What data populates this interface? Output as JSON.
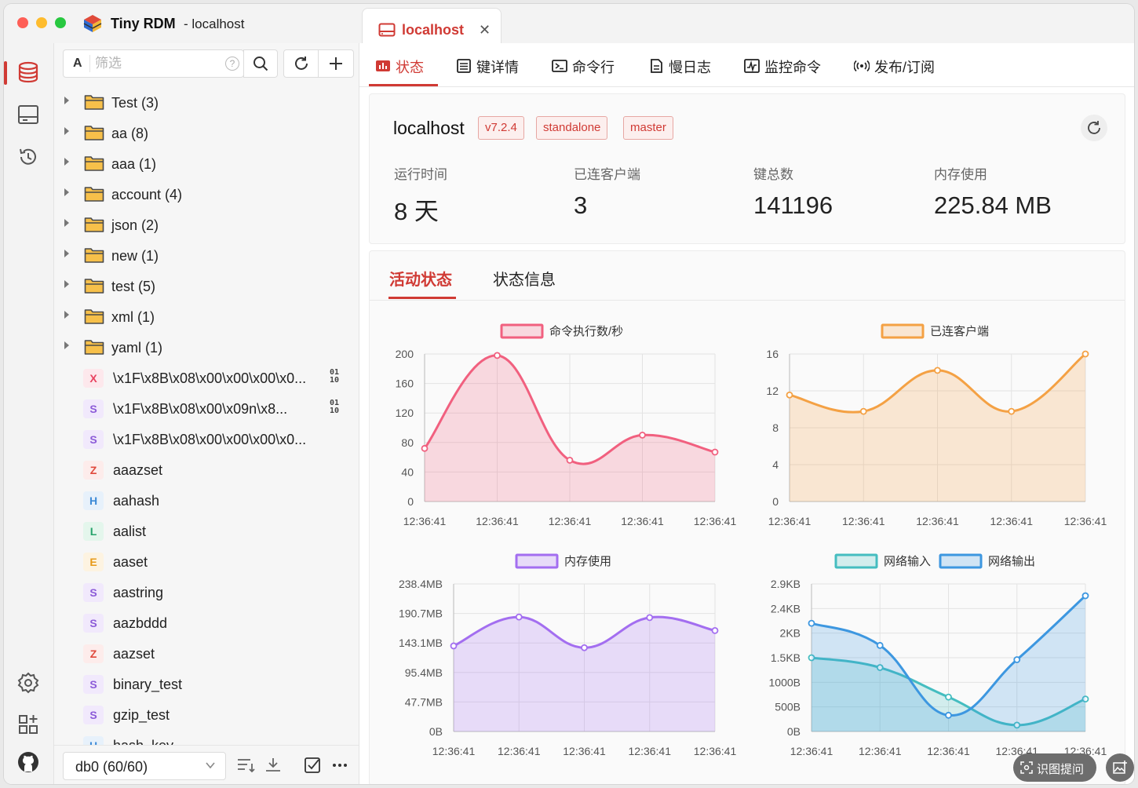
{
  "app": {
    "name": "Tiny RDM",
    "subtitle": "- localhost"
  },
  "tab": {
    "label": "localhost",
    "close": "✕"
  },
  "sidebar": {
    "search_mode": "A",
    "search_placeholder": "筛选",
    "search_help": "?",
    "groups": [
      {
        "label": "Test (3)"
      },
      {
        "label": "aa (8)"
      },
      {
        "label": "aaa (1)"
      },
      {
        "label": "account (4)"
      },
      {
        "label": "json (2)"
      },
      {
        "label": "new (1)"
      },
      {
        "label": "test (5)"
      },
      {
        "label": "xml (1)"
      },
      {
        "label": "yaml (1)"
      }
    ],
    "keys": [
      {
        "type": "X",
        "label": "\\x1F\\x8B\\x08\\x00\\x00\\x00\\x0...",
        "binary": true
      },
      {
        "type": "S",
        "label": "\\x1F\\x8B\\x08\\x00\\x09n\\x8...",
        "binary": true
      },
      {
        "type": "S",
        "label": "\\x1F\\x8B\\x08\\x00\\x00\\x00\\x0...",
        "binary": false
      },
      {
        "type": "Z",
        "label": "aaazset",
        "binary": false
      },
      {
        "type": "H",
        "label": "aahash",
        "binary": false
      },
      {
        "type": "L",
        "label": "aalist",
        "binary": false
      },
      {
        "type": "E",
        "label": "aaset",
        "binary": false
      },
      {
        "type": "S",
        "label": "aastring",
        "binary": false
      },
      {
        "type": "S",
        "label": "aazbddd",
        "binary": false
      },
      {
        "type": "Z",
        "label": "aazset",
        "binary": false
      },
      {
        "type": "S",
        "label": "binary_test",
        "binary": false
      },
      {
        "type": "S",
        "label": "gzip_test",
        "binary": false
      },
      {
        "type": "H",
        "label": "hash_key",
        "binary": false
      }
    ],
    "binary_badge_top": "01",
    "binary_badge_bottom": "10",
    "db_select": "db0 (60/60)"
  },
  "type_colors": {
    "X": {
      "fg": "#e8425f",
      "bg": "#fde8ec"
    },
    "S": {
      "fg": "#8c5bd8",
      "bg": "#f1e9fc"
    },
    "Z": {
      "fg": "#e0493c",
      "bg": "#fdeceb"
    },
    "H": {
      "fg": "#3d8ad6",
      "bg": "#e7f1fb"
    },
    "L": {
      "fg": "#25a36a",
      "bg": "#e4f6ec"
    },
    "E": {
      "fg": "#e69a19",
      "bg": "#fdf3e1"
    }
  },
  "subtabs": [
    "状态",
    "键详情",
    "命令行",
    "慢日志",
    "监控命令",
    "发布/订阅"
  ],
  "server": {
    "name": "localhost",
    "tags": [
      "v7.2.4",
      "standalone",
      "master"
    ],
    "stats": [
      {
        "label": "运行时间",
        "value": "8 天"
      },
      {
        "label": "已连客户端",
        "value": "3"
      },
      {
        "label": "键总数",
        "value": "141196"
      },
      {
        "label": "内存使用",
        "value": "225.84 MB"
      }
    ]
  },
  "content_tabs": [
    "活动状态",
    "状态信息"
  ],
  "chart_data": [
    {
      "type": "area",
      "legend": [
        "命令执行数/秒"
      ],
      "x": [
        "12:36:41",
        "12:36:41",
        "12:36:41",
        "12:36:41",
        "12:36:41"
      ],
      "yticks": [
        "0",
        "40",
        "80",
        "120",
        "160",
        "200"
      ],
      "ylim": [
        0,
        200
      ],
      "series": [
        {
          "name": "命令执行数/秒",
          "values": [
            72,
            198,
            56,
            90,
            67
          ],
          "color": "#f1607f"
        }
      ]
    },
    {
      "type": "area",
      "legend": [
        "已连客户端"
      ],
      "x": [
        "12:36:41",
        "12:36:41",
        "12:36:41",
        "12:36:41",
        "12:36:41"
      ],
      "yticks": [
        "0",
        "4",
        "8",
        "12",
        "16"
      ],
      "ylim": [
        0,
        18
      ],
      "series": [
        {
          "name": "已连客户端",
          "values": [
            13,
            11,
            16,
            11,
            18
          ],
          "color": "#f4a144"
        }
      ]
    },
    {
      "type": "area",
      "legend": [
        "内存使用"
      ],
      "x": [
        "12:36:41",
        "12:36:41",
        "12:36:41",
        "12:36:41",
        "12:36:41"
      ],
      "yticks": [
        "0B",
        "47.7MB",
        "95.4MB",
        "143.1MB",
        "190.7MB",
        "238.4MB"
      ],
      "ylim": [
        0,
        250000000
      ],
      "series": [
        {
          "name": "内存使用",
          "values": [
            145000000,
            194000000,
            142000000,
            193000000,
            171000000
          ],
          "color": "#a36ef0"
        }
      ]
    },
    {
      "type": "area",
      "legend": [
        "网络输入",
        "网络输出"
      ],
      "x": [
        "12:36:41",
        "12:36:41",
        "12:36:41",
        "12:36:41",
        "12:36:41"
      ],
      "yticks": [
        "0B",
        "500B",
        "1000B",
        "1.5KB",
        "2KB",
        "2.4KB",
        "2.9KB"
      ],
      "ylim": [
        0,
        3000
      ],
      "series": [
        {
          "name": "网络输入",
          "values": [
            1500,
            1300,
            700,
            130,
            660
          ],
          "color": "#45bdc0"
        },
        {
          "name": "网络输出",
          "values": [
            2200,
            1750,
            330,
            1460,
            2760
          ],
          "color": "#3d97e0"
        }
      ]
    }
  ],
  "overlay": {
    "ocr_label": "识图提问"
  }
}
